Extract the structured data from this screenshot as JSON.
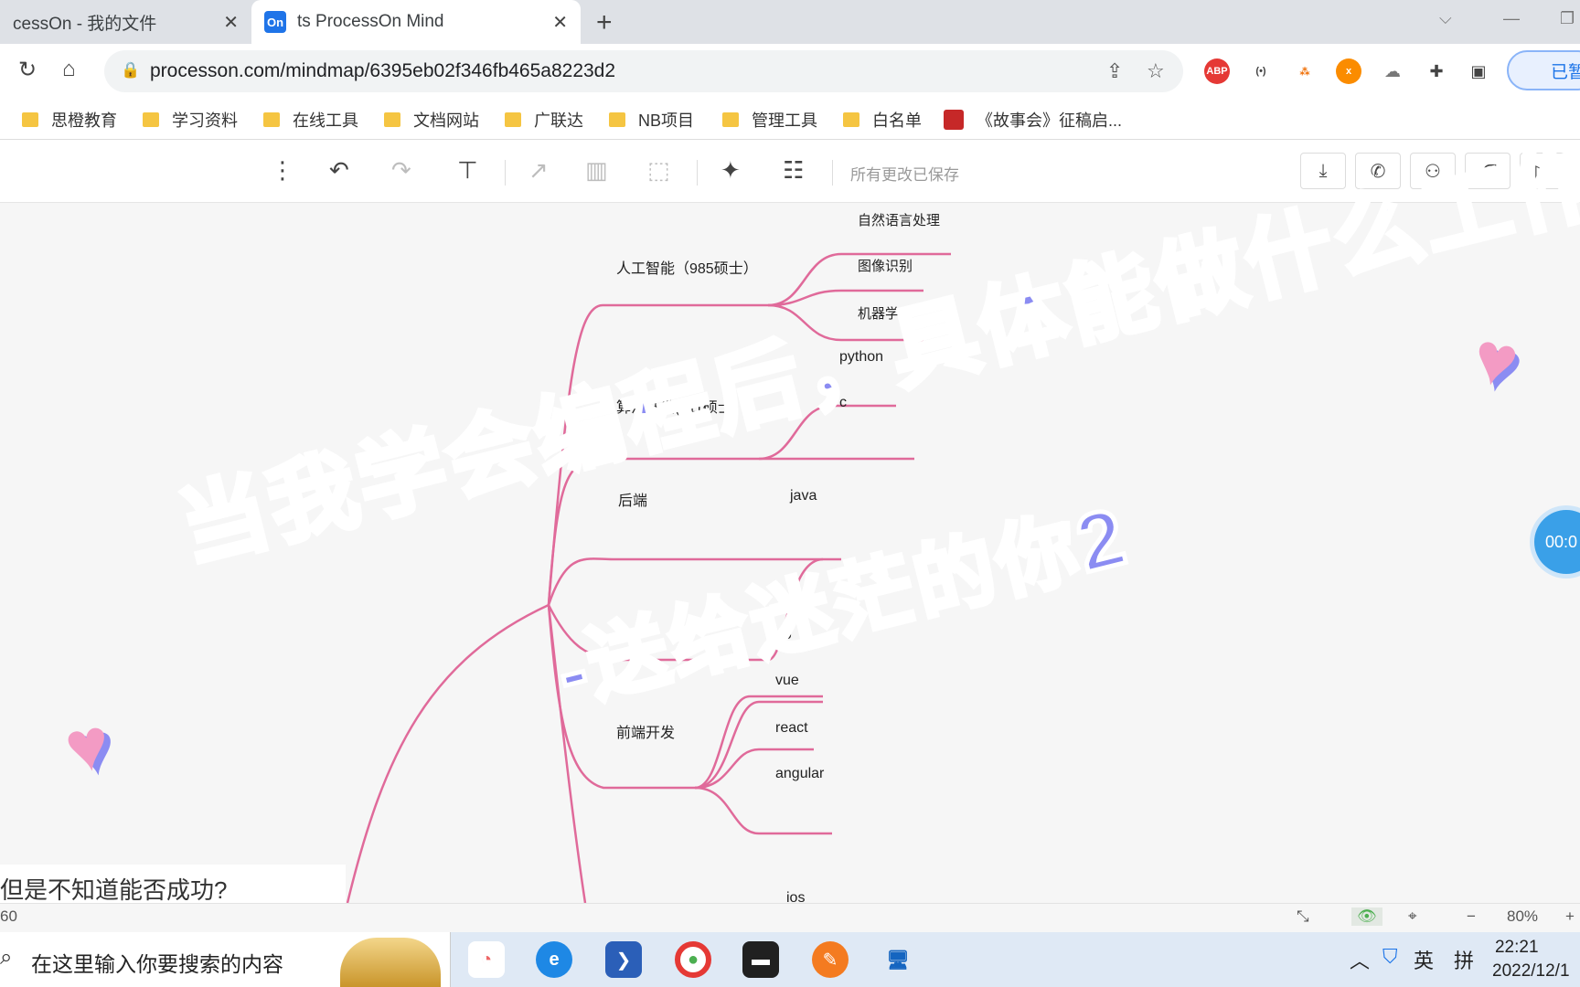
{
  "browser": {
    "tabs": [
      {
        "title": "cessOn - 我的文件",
        "favicon": "none",
        "active": false
      },
      {
        "title": "ts ProcessOn Mind",
        "favicon": "On",
        "active": true
      }
    ],
    "url": "processon.com/mindmap/6395eb02f346fb465a8223d2",
    "profile_label": "已暂",
    "extensions": [
      {
        "name": "ABP",
        "color": "#e53935"
      },
      {
        "name": "(•)",
        "color": "#555555"
      },
      {
        "name": "net",
        "color": "#ef6c00"
      },
      {
        "name": "x",
        "color": "#fb8c00"
      }
    ]
  },
  "bookmarks": [
    {
      "label": "思橙教育",
      "icon": "folder-icon"
    },
    {
      "label": "学习资料",
      "icon": "folder-icon"
    },
    {
      "label": "在线工具",
      "icon": "folder-icon"
    },
    {
      "label": "文档网站",
      "icon": "folder-icon"
    },
    {
      "label": "广联达",
      "icon": "folder-icon"
    },
    {
      "label": "NB项目",
      "icon": "folder-icon"
    },
    {
      "label": "管理工具",
      "icon": "folder-icon"
    },
    {
      "label": "白名单",
      "icon": "folder-icon"
    },
    {
      "label": "《故事会》征稿启...",
      "icon": "site-icon"
    }
  ],
  "toolbar": {
    "saved_status": "所有更改已保存"
  },
  "mindmap": {
    "branches": [
      {
        "label": "人工智能（985硕士）",
        "children": [
          "自然语言处理",
          "图像识别",
          "机器学习"
        ]
      },
      {
        "label": "算法开发(211硕士)",
        "children": [
          "python",
          "c"
        ]
      },
      {
        "label": "后端",
        "children": [
          "java"
        ]
      },
      {
        "label": "",
        "children": [
          "go"
        ]
      },
      {
        "label": "前端开发",
        "children": [
          "vue",
          "react",
          "angular"
        ]
      }
    ],
    "cut_node": "ios",
    "bottom_note": "但是不知道能否成功?",
    "accent_color": "#e06a9a"
  },
  "recording_timer": "00:0",
  "overlay": {
    "line1": "当我学会编程后，具体能做什么工作",
    "line2": "-送给迷茫的你2",
    "color": "#8b8cf2"
  },
  "statusbar": {
    "left_value": "60",
    "zoom": "80%"
  },
  "taskbar": {
    "search_placeholder": "在这里输入你要搜索的内容",
    "ime_lang": "英",
    "ime_mode": "拼",
    "time": "22:21",
    "date": "2022/12/1"
  }
}
